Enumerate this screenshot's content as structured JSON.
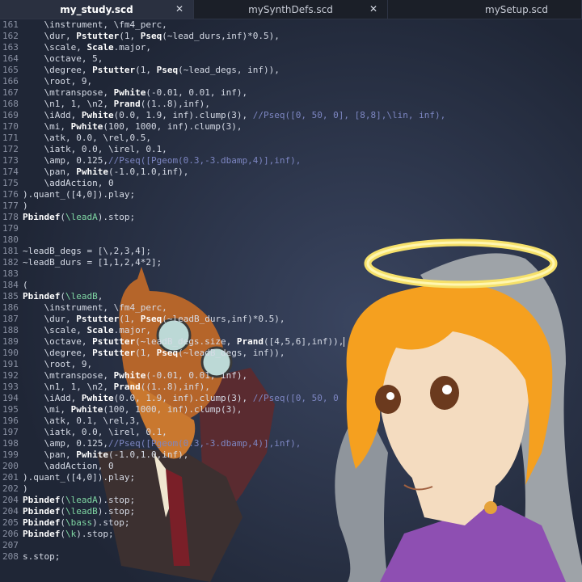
{
  "tabs": [
    {
      "label": "my_study.scd",
      "active": true,
      "close": "✕"
    },
    {
      "label": "mySynthDefs.scd",
      "active": false,
      "close": "✕"
    },
    {
      "label": "mySetup.scd",
      "active": false,
      "close": ""
    }
  ],
  "editor": {
    "lines": [
      {
        "n": "161",
        "segs": [
          [
            "c",
            "    \\instrument, \\fm4_perc,"
          ]
        ]
      },
      {
        "n": "162",
        "segs": [
          [
            "c",
            "    \\dur, "
          ],
          [
            "k",
            "Pstutter"
          ],
          [
            "c",
            "(1, "
          ],
          [
            "k",
            "Pseq"
          ],
          [
            "c",
            "(~lead_durs,inf)*0.5),"
          ]
        ]
      },
      {
        "n": "163",
        "segs": [
          [
            "c",
            "    \\scale, "
          ],
          [
            "k",
            "Scale"
          ],
          [
            "c",
            ".major,"
          ]
        ]
      },
      {
        "n": "164",
        "segs": [
          [
            "c",
            "    \\octave, 5,"
          ]
        ]
      },
      {
        "n": "165",
        "segs": [
          [
            "c",
            "    \\degree, "
          ],
          [
            "k",
            "Pstutter"
          ],
          [
            "c",
            "(1, "
          ],
          [
            "k",
            "Pseq"
          ],
          [
            "c",
            "(~lead_degs, inf)),"
          ]
        ]
      },
      {
        "n": "166",
        "segs": [
          [
            "c",
            "    \\root, 9,"
          ]
        ]
      },
      {
        "n": "167",
        "segs": [
          [
            "c",
            "    \\mtranspose, "
          ],
          [
            "k",
            "Pwhite"
          ],
          [
            "c",
            "(-0.01, 0.01, inf),"
          ]
        ]
      },
      {
        "n": "168",
        "segs": [
          [
            "c",
            "    \\n1, 1, \\n2, "
          ],
          [
            "k",
            "Prand"
          ],
          [
            "c",
            "((1..8),inf),"
          ]
        ]
      },
      {
        "n": "169",
        "segs": [
          [
            "c",
            "    \\iAdd, "
          ],
          [
            "k",
            "Pwhite"
          ],
          [
            "c",
            "(0.0, 1.9, inf).clump(3), "
          ],
          [
            "m",
            "//Pseq([0, 50, 0], [8,8],\\lin, inf),"
          ]
        ]
      },
      {
        "n": "170",
        "segs": [
          [
            "c",
            "    \\mi, "
          ],
          [
            "k",
            "Pwhite"
          ],
          [
            "c",
            "(100, 1000, inf).clump(3),"
          ]
        ]
      },
      {
        "n": "171",
        "segs": [
          [
            "c",
            "    \\atk, 0.0, \\rel,0.5,"
          ]
        ]
      },
      {
        "n": "172",
        "segs": [
          [
            "c",
            "    \\iatk, 0.0, \\irel, 0.1,"
          ]
        ]
      },
      {
        "n": "173",
        "segs": [
          [
            "c",
            "    \\amp, 0.125,"
          ],
          [
            "m",
            "//Pseq([Pgeom(0.3,-3.dbamp,4)],inf),"
          ]
        ]
      },
      {
        "n": "174",
        "segs": [
          [
            "c",
            "    \\pan, "
          ],
          [
            "k",
            "Pwhite"
          ],
          [
            "c",
            "(-1.0,1.0,inf),"
          ]
        ]
      },
      {
        "n": "175",
        "segs": [
          [
            "c",
            "    \\addAction, 0"
          ]
        ]
      },
      {
        "n": "176",
        "segs": [
          [
            "c",
            ").quant_([4,0]).play;"
          ]
        ]
      },
      {
        "n": "177",
        "segs": [
          [
            "c",
            ")"
          ]
        ]
      },
      {
        "n": "178",
        "segs": [
          [
            "k",
            "Pbindef"
          ],
          [
            "c",
            "("
          ],
          [
            "s",
            "\\leadA"
          ],
          [
            "c",
            ").stop;"
          ]
        ]
      },
      {
        "n": "179",
        "segs": [
          [
            "c",
            ""
          ]
        ]
      },
      {
        "n": "180",
        "segs": [
          [
            "c",
            ""
          ]
        ]
      },
      {
        "n": "181",
        "segs": [
          [
            "c",
            "~leadB_degs = [\\,2,3,4];"
          ]
        ]
      },
      {
        "n": "182",
        "segs": [
          [
            "c",
            "~leadB_durs = [1,1,2,4*2];"
          ]
        ]
      },
      {
        "n": "183",
        "segs": [
          [
            "c",
            ""
          ]
        ]
      },
      {
        "n": "184",
        "segs": [
          [
            "c",
            "("
          ]
        ]
      },
      {
        "n": "185",
        "segs": [
          [
            "k",
            "Pbindef"
          ],
          [
            "c",
            "("
          ],
          [
            "s",
            "\\leadB"
          ],
          [
            "c",
            ","
          ]
        ]
      },
      {
        "n": "186",
        "segs": [
          [
            "c",
            "    \\instrument, \\fm4_perc,"
          ]
        ]
      },
      {
        "n": "187",
        "segs": [
          [
            "c",
            "    \\dur, "
          ],
          [
            "k",
            "Pstutter"
          ],
          [
            "c",
            "(1, "
          ],
          [
            "k",
            "Pseq"
          ],
          [
            "c",
            "(~leadB_durs,inf)*0.5),"
          ]
        ]
      },
      {
        "n": "188",
        "segs": [
          [
            "c",
            "    \\scale, "
          ],
          [
            "k",
            "Scale"
          ],
          [
            "c",
            ".major,"
          ]
        ]
      },
      {
        "n": "189",
        "segs": [
          [
            "c",
            "    \\octave, "
          ],
          [
            "k",
            "Pstutter"
          ],
          [
            "c",
            "(~leadB_degs.size, "
          ],
          [
            "k",
            "Prand"
          ],
          [
            "c",
            "([4,5,6],inf)),"
          ],
          [
            "cur",
            ""
          ]
        ]
      },
      {
        "n": "190",
        "segs": [
          [
            "c",
            "    \\degree, "
          ],
          [
            "k",
            "Pstutter"
          ],
          [
            "c",
            "(1, "
          ],
          [
            "k",
            "Pseq"
          ],
          [
            "c",
            "(~leadB_degs, inf)),"
          ]
        ]
      },
      {
        "n": "191",
        "segs": [
          [
            "c",
            "    \\root, 9,"
          ]
        ]
      },
      {
        "n": "192",
        "segs": [
          [
            "c",
            "    \\mtranspose, "
          ],
          [
            "k",
            "Pwhite"
          ],
          [
            "c",
            "(-0.01, 0.01, inf),"
          ]
        ]
      },
      {
        "n": "193",
        "segs": [
          [
            "c",
            "    \\n1, 1, \\n2, "
          ],
          [
            "k",
            "Prand"
          ],
          [
            "c",
            "((1..8),inf),"
          ]
        ]
      },
      {
        "n": "194",
        "segs": [
          [
            "c",
            "    \\iAdd, "
          ],
          [
            "k",
            "Pwhite"
          ],
          [
            "c",
            "(0.0, 1.9, inf).clump(3), "
          ],
          [
            "m",
            "//Pseq([0, 50, 0"
          ]
        ]
      },
      {
        "n": "195",
        "segs": [
          [
            "c",
            "    \\mi, "
          ],
          [
            "k",
            "Pwhite"
          ],
          [
            "c",
            "(100, 1000, inf).clump(3),"
          ]
        ]
      },
      {
        "n": "196",
        "segs": [
          [
            "c",
            "    \\atk, 0.1, \\rel,3,"
          ]
        ]
      },
      {
        "n": "197",
        "segs": [
          [
            "c",
            "    \\iatk, 0.0, \\irel, 0.1,"
          ]
        ]
      },
      {
        "n": "198",
        "segs": [
          [
            "c",
            "    \\amp, 0.125,"
          ],
          [
            "m",
            "//Pseq([Pgeom(0.3,-3.dbamp,4)],inf),"
          ]
        ]
      },
      {
        "n": "199",
        "segs": [
          [
            "c",
            "    \\pan, "
          ],
          [
            "k",
            "Pwhite"
          ],
          [
            "c",
            "(-1.0,1.0,inf),"
          ]
        ]
      },
      {
        "n": "200",
        "segs": [
          [
            "c",
            "    \\addAction, 0"
          ]
        ]
      },
      {
        "n": "201",
        "segs": [
          [
            "c",
            ").quant_([4,0]).play;"
          ]
        ]
      },
      {
        "n": "202",
        "segs": [
          [
            "c",
            ")"
          ]
        ]
      },
      {
        "n": "204",
        "segs": [
          [
            "k",
            "Pbindef"
          ],
          [
            "c",
            "("
          ],
          [
            "s",
            "\\leadA"
          ],
          [
            "c",
            ").stop;"
          ]
        ]
      },
      {
        "n": "204",
        "segs": [
          [
            "k",
            "Pbindef"
          ],
          [
            "c",
            "("
          ],
          [
            "s",
            "\\leadB"
          ],
          [
            "c",
            ").stop;"
          ]
        ]
      },
      {
        "n": "205",
        "segs": [
          [
            "k",
            "Pbindef"
          ],
          [
            "c",
            "("
          ],
          [
            "s",
            "\\bass"
          ],
          [
            "c",
            ").stop;"
          ]
        ]
      },
      {
        "n": "206",
        "segs": [
          [
            "k",
            "Pbindef"
          ],
          [
            "c",
            "("
          ],
          [
            "s",
            "\\k"
          ],
          [
            "c",
            ").stop;"
          ]
        ]
      },
      {
        "n": "207",
        "segs": [
          [
            "c",
            ""
          ]
        ]
      },
      {
        "n": "208",
        "segs": [
          [
            "c",
            "s.stop;"
          ]
        ]
      }
    ]
  }
}
